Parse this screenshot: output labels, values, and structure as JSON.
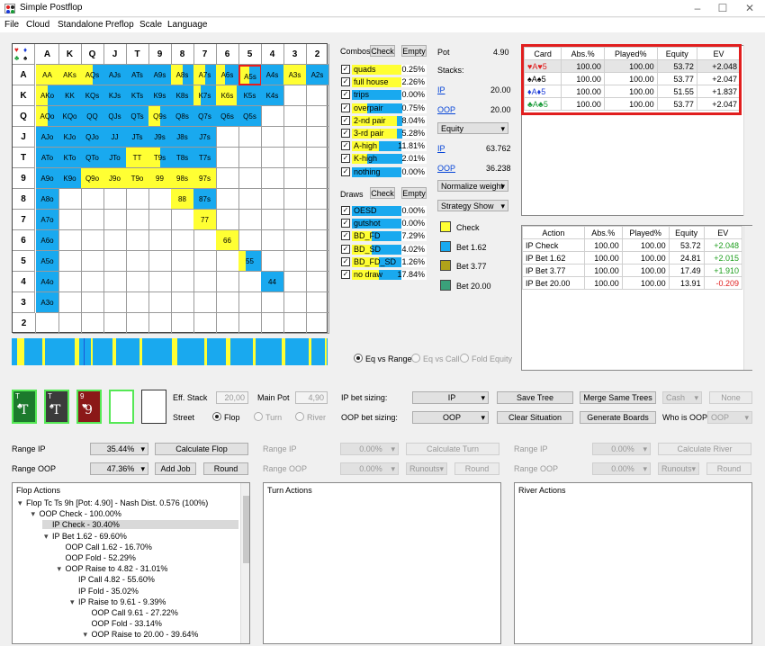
{
  "app": {
    "title": "Simple Postflop"
  },
  "menu": [
    "File",
    "Cloud",
    "Standalone",
    "Preflop",
    "Scale",
    "Language"
  ],
  "grid": {
    "ranks": [
      "A",
      "K",
      "Q",
      "J",
      "T",
      "9",
      "8",
      "7",
      "6",
      "5",
      "4",
      "3",
      "2"
    ],
    "cells": [
      {
        "r": 0,
        "c": 0,
        "t": "AA",
        "y": 1,
        "b": 0,
        "hl": false
      },
      {
        "r": 0,
        "c": 1,
        "t": "AKs",
        "y": 1,
        "b": 0,
        "hl": false
      },
      {
        "r": 0,
        "c": 2,
        "t": "AQs",
        "y": 0.5,
        "b": 0.5,
        "hl": false
      },
      {
        "r": 0,
        "c": 3,
        "t": "AJs",
        "y": 0,
        "b": 1,
        "hl": false
      },
      {
        "r": 0,
        "c": 4,
        "t": "ATs",
        "y": 0,
        "b": 1,
        "hl": false
      },
      {
        "r": 0,
        "c": 5,
        "t": "A9s",
        "y": 0,
        "b": 1,
        "hl": false
      },
      {
        "r": 0,
        "c": 6,
        "t": "A8s",
        "y": 0.5,
        "b": 0.5,
        "hl": false
      },
      {
        "r": 0,
        "c": 7,
        "t": "A7s",
        "y": 0.5,
        "b": 0.5,
        "hl": false
      },
      {
        "r": 0,
        "c": 8,
        "t": "A6s",
        "y": 0.4,
        "b": 0.6,
        "hl": false
      },
      {
        "r": 0,
        "c": 9,
        "t": "A5s",
        "y": 0.4,
        "b": 0.6,
        "hl": true
      },
      {
        "r": 0,
        "c": 10,
        "t": "A4s",
        "y": 0,
        "b": 1,
        "hl": false
      },
      {
        "r": 0,
        "c": 11,
        "t": "A3s",
        "y": 1,
        "b": 0,
        "hl": false
      },
      {
        "r": 0,
        "c": 12,
        "t": "A2s",
        "y": 0,
        "b": 1,
        "hl": false
      },
      {
        "r": 1,
        "c": 0,
        "t": "AKo",
        "y": 0.5,
        "b": 0.5,
        "hl": false
      },
      {
        "r": 1,
        "c": 1,
        "t": "KK",
        "y": 0,
        "b": 1,
        "hl": false
      },
      {
        "r": 1,
        "c": 2,
        "t": "KQs",
        "y": 0,
        "b": 1,
        "hl": false
      },
      {
        "r": 1,
        "c": 3,
        "t": "KJs",
        "y": 0,
        "b": 1,
        "hl": false
      },
      {
        "r": 1,
        "c": 4,
        "t": "KTs",
        "y": 0,
        "b": 1,
        "hl": false
      },
      {
        "r": 1,
        "c": 5,
        "t": "K9s",
        "y": 0,
        "b": 1,
        "hl": false
      },
      {
        "r": 1,
        "c": 6,
        "t": "K8s",
        "y": 0,
        "b": 1,
        "hl": false
      },
      {
        "r": 1,
        "c": 7,
        "t": "K7s",
        "y": 0.3,
        "b": 0.7,
        "hl": false
      },
      {
        "r": 1,
        "c": 8,
        "t": "K6s",
        "y": 0.9,
        "b": 0.1,
        "hl": false
      },
      {
        "r": 1,
        "c": 9,
        "t": "K5s",
        "y": 0,
        "b": 1,
        "hl": false
      },
      {
        "r": 1,
        "c": 10,
        "t": "K4s",
        "y": 0,
        "b": 1,
        "hl": false
      },
      {
        "r": 2,
        "c": 0,
        "t": "AQo",
        "y": 0.5,
        "b": 0.5,
        "hl": false
      },
      {
        "r": 2,
        "c": 1,
        "t": "KQo",
        "y": 0,
        "b": 1,
        "hl": false
      },
      {
        "r": 2,
        "c": 2,
        "t": "QQ",
        "y": 0,
        "b": 1,
        "hl": false
      },
      {
        "r": 2,
        "c": 3,
        "t": "QJs",
        "y": 0,
        "b": 1,
        "hl": false
      },
      {
        "r": 2,
        "c": 4,
        "t": "QTs",
        "y": 0,
        "b": 1,
        "hl": false
      },
      {
        "r": 2,
        "c": 5,
        "t": "Q9s",
        "y": 0.5,
        "b": 0.5,
        "hl": false
      },
      {
        "r": 2,
        "c": 6,
        "t": "Q8s",
        "y": 0,
        "b": 1,
        "hl": false
      },
      {
        "r": 2,
        "c": 7,
        "t": "Q7s",
        "y": 0,
        "b": 1,
        "hl": false
      },
      {
        "r": 2,
        "c": 8,
        "t": "Q6s",
        "y": 0,
        "b": 1,
        "hl": false
      },
      {
        "r": 2,
        "c": 9,
        "t": "Q5s",
        "y": 0,
        "b": 1,
        "hl": false
      },
      {
        "r": 3,
        "c": 0,
        "t": "AJo",
        "y": 0,
        "b": 1,
        "hl": false
      },
      {
        "r": 3,
        "c": 1,
        "t": "KJo",
        "y": 0,
        "b": 1,
        "hl": false
      },
      {
        "r": 3,
        "c": 2,
        "t": "QJo",
        "y": 0,
        "b": 1,
        "hl": false
      },
      {
        "r": 3,
        "c": 3,
        "t": "JJ",
        "y": 0,
        "b": 1,
        "hl": false
      },
      {
        "r": 3,
        "c": 4,
        "t": "JTs",
        "y": 0,
        "b": 1,
        "hl": false
      },
      {
        "r": 3,
        "c": 5,
        "t": "J9s",
        "y": 0,
        "b": 1,
        "hl": false
      },
      {
        "r": 3,
        "c": 6,
        "t": "J8s",
        "y": 0,
        "b": 1,
        "hl": false
      },
      {
        "r": 3,
        "c": 7,
        "t": "J7s",
        "y": 0,
        "b": 1,
        "hl": false
      },
      {
        "r": 4,
        "c": 0,
        "t": "ATo",
        "y": 0,
        "b": 1,
        "hl": false
      },
      {
        "r": 4,
        "c": 1,
        "t": "KTo",
        "y": 0,
        "b": 1,
        "hl": false
      },
      {
        "r": 4,
        "c": 2,
        "t": "QTo",
        "y": 0,
        "b": 1,
        "hl": false
      },
      {
        "r": 4,
        "c": 3,
        "t": "JTo",
        "y": 0,
        "b": 1,
        "hl": false
      },
      {
        "r": 4,
        "c": 4,
        "t": "TT",
        "y": 1,
        "b": 0,
        "hl": false
      },
      {
        "r": 4,
        "c": 5,
        "t": "T9s",
        "y": 0.5,
        "b": 0.5,
        "hl": false
      },
      {
        "r": 4,
        "c": 6,
        "t": "T8s",
        "y": 0,
        "b": 1,
        "hl": false
      },
      {
        "r": 4,
        "c": 7,
        "t": "T7s",
        "y": 0,
        "b": 1,
        "hl": false
      },
      {
        "r": 5,
        "c": 0,
        "t": "A9o",
        "y": 0,
        "b": 1,
        "hl": false
      },
      {
        "r": 5,
        "c": 1,
        "t": "K9o",
        "y": 0,
        "b": 1,
        "hl": false
      },
      {
        "r": 5,
        "c": 2,
        "t": "Q9o",
        "y": 1,
        "b": 0,
        "hl": false
      },
      {
        "r": 5,
        "c": 3,
        "t": "J9o",
        "y": 1,
        "b": 0,
        "hl": false
      },
      {
        "r": 5,
        "c": 4,
        "t": "T9o",
        "y": 1,
        "b": 0,
        "hl": false
      },
      {
        "r": 5,
        "c": 5,
        "t": "99",
        "y": 1,
        "b": 0,
        "hl": false
      },
      {
        "r": 5,
        "c": 6,
        "t": "98s",
        "y": 1,
        "b": 0,
        "hl": false
      },
      {
        "r": 5,
        "c": 7,
        "t": "97s",
        "y": 1,
        "b": 0,
        "hl": false
      },
      {
        "r": 6,
        "c": 0,
        "t": "A8o",
        "y": 0,
        "b": 1,
        "hl": false
      },
      {
        "r": 6,
        "c": 6,
        "t": "88",
        "y": 1,
        "b": 0,
        "hl": false
      },
      {
        "r": 6,
        "c": 7,
        "t": "87s",
        "y": 0,
        "b": 1,
        "hl": false
      },
      {
        "r": 7,
        "c": 0,
        "t": "A7o",
        "y": 0,
        "b": 1,
        "hl": false
      },
      {
        "r": 7,
        "c": 7,
        "t": "77",
        "y": 1,
        "b": 0,
        "hl": false
      },
      {
        "r": 8,
        "c": 0,
        "t": "A6o",
        "y": 0,
        "b": 1,
        "hl": false
      },
      {
        "r": 8,
        "c": 8,
        "t": "66",
        "y": 1,
        "b": 0,
        "hl": false
      },
      {
        "r": 9,
        "c": 0,
        "t": "A5o",
        "y": 0,
        "b": 1,
        "hl": false
      },
      {
        "r": 9,
        "c": 9,
        "t": "55",
        "y": 0.3,
        "b": 0.7,
        "hl": false
      },
      {
        "r": 10,
        "c": 0,
        "t": "A4o",
        "y": 0,
        "b": 1,
        "hl": false
      },
      {
        "r": 10,
        "c": 10,
        "t": "44",
        "y": 0,
        "b": 1,
        "hl": false
      },
      {
        "r": 11,
        "c": 0,
        "t": "A3o",
        "y": 0,
        "b": 1,
        "hl": false
      },
      {
        "r": 12,
        "c": 0,
        "t": "2",
        "y": 0,
        "b": 0,
        "hl": false
      }
    ]
  },
  "combos": {
    "label": "Combos",
    "check": "Check",
    "empty": "Empty",
    "items": [
      {
        "name": "quads",
        "pct": "0.25%",
        "y": 1,
        "b": 0
      },
      {
        "name": "full house",
        "pct": "2.26%",
        "y": 1,
        "b": 0
      },
      {
        "name": "trips",
        "pct": "0.00%",
        "y": 0,
        "b": 1
      },
      {
        "name": "overpair",
        "pct": "0.75%",
        "y": 0.3,
        "b": 0.7
      },
      {
        "name": "2-nd pair",
        "pct": "8.04%",
        "y": 0.9,
        "b": 0.1
      },
      {
        "name": "3-rd pair",
        "pct": "5.28%",
        "y": 0.9,
        "b": 0.1
      },
      {
        "name": "A-high",
        "pct": "11.81%",
        "y": 0.55,
        "b": 0.45
      },
      {
        "name": "K-high",
        "pct": "2.01%",
        "y": 0.3,
        "b": 0.7
      },
      {
        "name": "nothing",
        "pct": "0.00%",
        "y": 0,
        "b": 1
      }
    ]
  },
  "draws": {
    "label": "Draws",
    "check": "Check",
    "empty": "Empty",
    "items": [
      {
        "name": "OESD",
        "pct": "0.00%",
        "y": 0,
        "b": 1
      },
      {
        "name": "gutshot",
        "pct": "0.00%",
        "y": 0,
        "b": 1
      },
      {
        "name": "BD_FD",
        "pct": "7.29%",
        "y": 0.4,
        "b": 0.6
      },
      {
        "name": "BD_SD",
        "pct": "4.02%",
        "y": 0.4,
        "b": 0.6
      },
      {
        "name": "BD_FD_SD",
        "pct": "1.26%",
        "y": 0.55,
        "b": 0.45
      },
      {
        "name": "no draw",
        "pct": "17.84%",
        "y": 0.55,
        "b": 0.45
      }
    ]
  },
  "pot": {
    "label": "Pot",
    "value": "4.90",
    "stacks_label": "Stacks:",
    "ip_label": "IP",
    "ip_value": "20.00",
    "oop_label": "OOP",
    "oop_value": "20.00",
    "equity_select": "Equity",
    "ip_eq_label": "IP",
    "ip_eq": "63.762",
    "oop_eq_label": "OOP",
    "oop_eq": "36.238",
    "normalize_select": "Normalize weight",
    "strategy_select": "Strategy Show"
  },
  "legend": [
    {
      "label": "Check",
      "color": "#ffff33"
    },
    {
      "label": "Bet 1.62",
      "color": "#19a9ef"
    },
    {
      "label": "Bet 3.77",
      "color": "#b0a31a"
    },
    {
      "label": "Bet 20.00",
      "color": "#3aa07a"
    }
  ],
  "card_table": {
    "headers": [
      "Card",
      "Abs.%",
      "Played%",
      "Equity",
      "EV"
    ],
    "rows": [
      {
        "s1": "♥",
        "r1": "A",
        "s2": "♥",
        "r2": "5",
        "cls": "red",
        "abs": "100.00",
        "played": "100.00",
        "eq": "53.72",
        "ev": "+2.048"
      },
      {
        "s1": "♠",
        "r1": "A",
        "s2": "♠",
        "r2": "5",
        "cls": "",
        "abs": "100.00",
        "played": "100.00",
        "eq": "53.77",
        "ev": "+2.047"
      },
      {
        "s1": "♦",
        "r1": "A",
        "s2": "♦",
        "r2": "5",
        "cls": "blu",
        "abs": "100.00",
        "played": "100.00",
        "eq": "51.55",
        "ev": "+1.837"
      },
      {
        "s1": "♣",
        "r1": "A",
        "s2": "♣",
        "r2": "5",
        "cls": "grn",
        "abs": "100.00",
        "played": "100.00",
        "eq": "53.77",
        "ev": "+2.047"
      }
    ]
  },
  "action_table": {
    "headers": [
      "Action",
      "Abs.%",
      "Played%",
      "Equity",
      "EV"
    ],
    "rows": [
      {
        "action": "IP Check",
        "abs": "100.00",
        "played": "100.00",
        "eq": "53.72",
        "ev": "+2.048",
        "sign": "pos"
      },
      {
        "action": "IP Bet 1.62",
        "abs": "100.00",
        "played": "100.00",
        "eq": "24.81",
        "ev": "+2.015",
        "sign": "pos"
      },
      {
        "action": "IP Bet 3.77",
        "abs": "100.00",
        "played": "100.00",
        "eq": "17.49",
        "ev": "+1.910",
        "sign": "pos"
      },
      {
        "action": "IP Bet 20.00",
        "abs": "100.00",
        "played": "100.00",
        "eq": "13.91",
        "ev": "-0.209",
        "sign": "neg"
      }
    ]
  },
  "radios": {
    "eq_vs_range": "Eq vs Range",
    "eq_vs_call": "Eq vs Call",
    "fold_equity": "Fold Equity"
  },
  "board": {
    "cards": [
      {
        "rank": "T",
        "corner": "T",
        "suit": "♣",
        "bg": "#1c7a2c"
      },
      {
        "rank": "T",
        "corner": "T",
        "suit": "♠",
        "bg": "#3b3b3b"
      },
      {
        "rank": "9",
        "corner": "9",
        "suit": "♥",
        "bg": "#8b1818"
      }
    ],
    "eff_stack_label": "Eff. Stack",
    "eff_stack": "20,00",
    "main_pot_label": "Main Pot",
    "main_pot": "4,90",
    "street_label": "Street",
    "flop": "Flop",
    "turn": "Turn",
    "river": "River"
  },
  "controls": {
    "ip_bet_sizing": "IP bet sizing:",
    "ip_select": "IP",
    "oop_bet_sizing": "OOP bet sizing:",
    "oop_select": "OOP",
    "save_tree": "Save Tree",
    "clear_situation": "Clear Situation",
    "merge_same_trees": "Merge Same Trees",
    "generate_boards": "Generate Boards",
    "cash": "Cash",
    "none": "None",
    "who_is_oop": "Who is OOP:",
    "who_oop_select": "OOP"
  },
  "ranges": {
    "range_ip": "Range IP",
    "range_oop": "Range OOP",
    "flop_ip": "35.44%",
    "flop_oop": "47.36%",
    "calc_flop": "Calculate Flop",
    "add_job": "Add Job",
    "round": "Round",
    "turn_ip": "0.00%",
    "turn_oop": "0.00%",
    "calc_turn": "Calculate Turn",
    "runouts": "Runouts",
    "river_ip": "0.00%",
    "river_oop": "0.00%",
    "calc_river": "Calculate River"
  },
  "flop_actions": {
    "title": "Flop Actions",
    "lines": [
      {
        "t": "Flop Tc Ts 9h [Pot: 4.90] - Nash Dist. 0.576 (100%)",
        "lvl": 0,
        "tog": "▾",
        "sel": false
      },
      {
        "t": "OOP Check - 100.00%",
        "lvl": 1,
        "tog": "▾",
        "sel": false
      },
      {
        "t": "IP Check - 30.40%",
        "lvl": 2,
        "tog": "",
        "sel": true
      },
      {
        "t": "IP Bet 1.62 - 69.60%",
        "lvl": 2,
        "tog": "▾",
        "sel": false
      },
      {
        "t": "OOP Call 1.62 - 16.70%",
        "lvl": 3,
        "tog": "",
        "sel": false
      },
      {
        "t": "OOP Fold - 52.29%",
        "lvl": 3,
        "tog": "",
        "sel": false
      },
      {
        "t": "OOP Raise to 4.82 - 31.01%",
        "lvl": 3,
        "tog": "▾",
        "sel": false
      },
      {
        "t": "IP Call 4.82 - 55.60%",
        "lvl": 4,
        "tog": "",
        "sel": false
      },
      {
        "t": "IP Fold - 35.02%",
        "lvl": 4,
        "tog": "",
        "sel": false
      },
      {
        "t": "IP Raise to 9.61 - 9.39%",
        "lvl": 4,
        "tog": "▾",
        "sel": false
      },
      {
        "t": "OOP Call 9.61 - 27.22%",
        "lvl": 5,
        "tog": "",
        "sel": false
      },
      {
        "t": "OOP Fold - 33.14%",
        "lvl": 5,
        "tog": "",
        "sel": false
      },
      {
        "t": "OOP Raise to 20.00 - 39.64%",
        "lvl": 5,
        "tog": "▾",
        "sel": false
      }
    ]
  },
  "turn_actions": {
    "title": "Turn Actions"
  },
  "river_actions": {
    "title": "River Actions"
  }
}
